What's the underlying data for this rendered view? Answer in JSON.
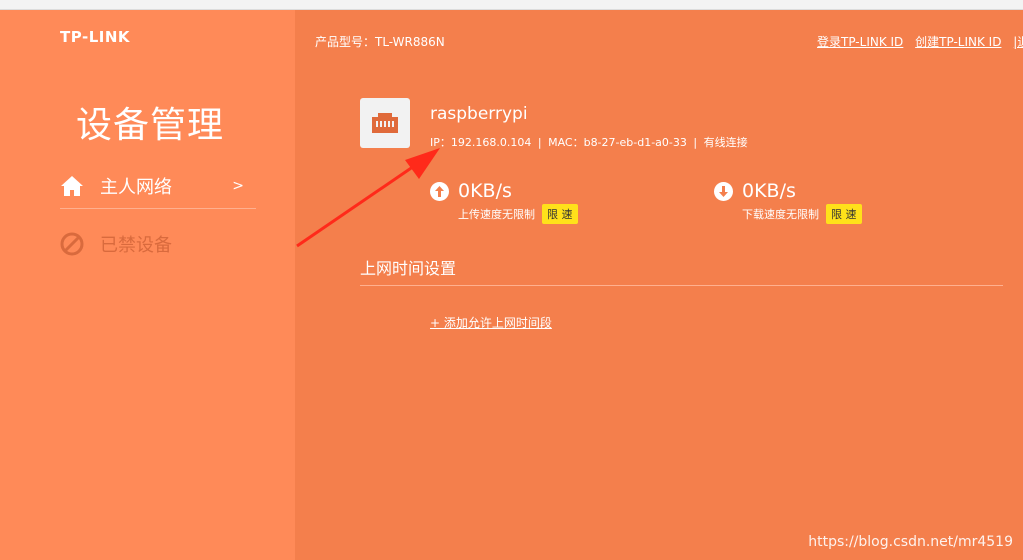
{
  "brand": {
    "logo_text": "TP-LINK"
  },
  "header": {
    "model_label": "产品型号：TL-WR886N",
    "links": [
      "登录TP-LINK ID",
      "创建TP-LINK ID",
      "|退出"
    ]
  },
  "sidebar": {
    "title": "设备管理",
    "items": [
      {
        "label": "主人网络",
        "chevron": ">",
        "icon": "home-icon"
      },
      {
        "label": "已禁设备",
        "icon": "block-icon"
      }
    ]
  },
  "device": {
    "icon": "ethernet-port-icon",
    "name": "raspberrypi",
    "ip_label": "IP：192.168.0.104",
    "mac_label": "MAC：b8-27-eb-d1-a0-33",
    "separator": "|",
    "connection": "有线连接"
  },
  "upload": {
    "icon": "arrow-up-circle-icon",
    "value": "0KB/s",
    "label": "上传速度无限制",
    "button": "限 速"
  },
  "download": {
    "icon": "arrow-down-circle-icon",
    "value": "0KB/s",
    "label": "下载速度无限制",
    "button": "限 速"
  },
  "internet_time": {
    "title": "上网时间设置",
    "add_link": "+ 添加允许上网时间段"
  },
  "watermark": "https://blog.csdn.net/mr4519",
  "colors": {
    "background": "#f47f4c",
    "sidebar": "#ff8a58",
    "limit_button": "#ffe11a",
    "annotation_arrow": "#ff2a1a"
  }
}
